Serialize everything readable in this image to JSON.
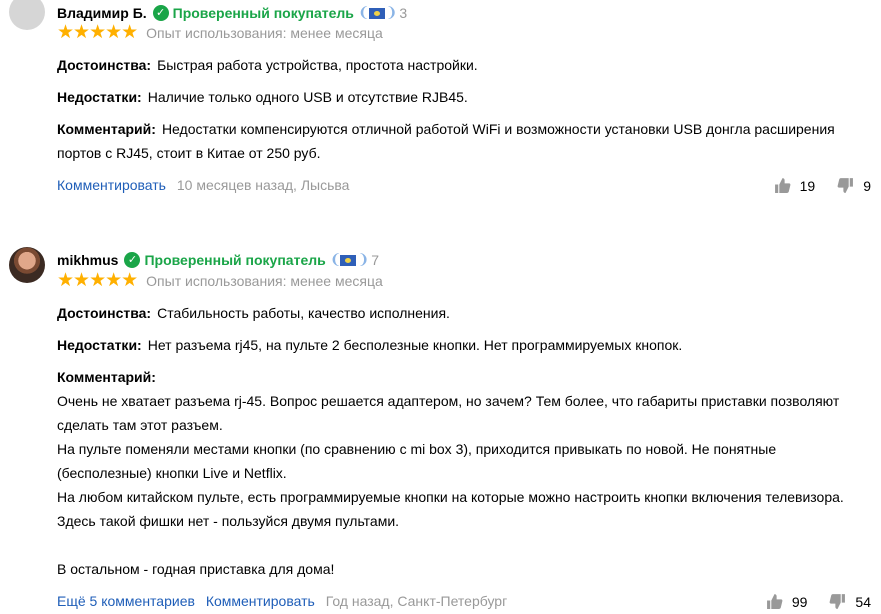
{
  "reviews": [
    {
      "author": "Владимир Б.",
      "verified_label": "Проверенный покупатель",
      "level": "3",
      "stars": "★★★★★",
      "experience": "Опыт использования: менее месяца",
      "pros_label": "Достоинства:",
      "pros": "Быстрая работа устройства, простота настройки.",
      "cons_label": "Недостатки:",
      "cons": "Наличие только одного USB и отсутствие RJB45.",
      "comment_label": "Комментарий:",
      "comment_line1": "Недостатки компенсируются отличной работой WiFi и возможности установки USB донгла расширения",
      "comment_line2": "портов с RJ45, стоит в Китае от 250 руб.",
      "comment_action": "Комментировать",
      "meta": "10 месяцев назад, Лысьва",
      "likes": "19",
      "dislikes": "9"
    },
    {
      "author": "mikhmus",
      "verified_label": "Проверенный покупатель",
      "level": "7",
      "stars": "★★★★★",
      "experience": "Опыт использования: менее месяца",
      "pros_label": "Достоинства:",
      "pros": "Стабильность работы, качество исполнения.",
      "cons_label": "Недостатки:",
      "cons": "Нет разъема rj45, на пульте 2 бесполезные кнопки. Нет программируемых кнопок.",
      "comment_label": "Комментарий:",
      "comment_lines": [
        "Очень не хватает разъема rj-45. Вопрос решается адаптером, но зачем? Тем более, что габариты приставки позволяют",
        "сделать там этот разъем.",
        "На пульте поменяли местами кнопки (по сравнению с mi box 3), приходится привыкать по новой. Не понятные",
        "(бесполезные) кнопки Live и Netflix.",
        "На любом китайском пульте, есть программируемые кнопки на которые можно настроить кнопки включения телевизора.",
        "Здесь такой фишки нет - пользуйся двумя пультами.",
        "",
        "В остальном - годная приставка для дома!"
      ],
      "more_comments": "Ещё 5 комментариев",
      "comment_action": "Комментировать",
      "meta": "Год назад, Санкт-Петербург",
      "likes": "99",
      "dislikes": "54"
    }
  ]
}
